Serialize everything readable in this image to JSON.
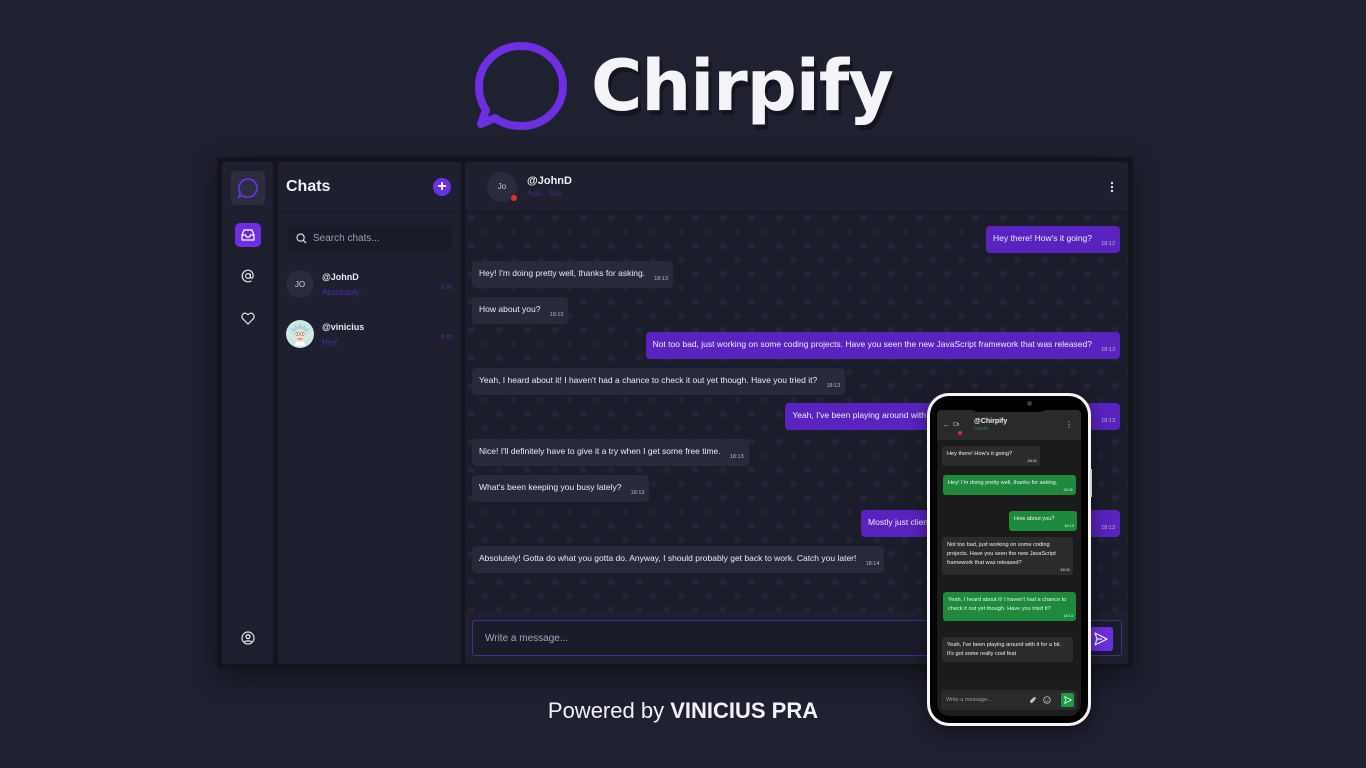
{
  "brand": {
    "name": "Chirpify",
    "accent": "#6d2fe0",
    "phone_accent": "#1e8a3d"
  },
  "sidebar": {
    "items": [
      {
        "icon": "logo-icon"
      },
      {
        "icon": "inbox-icon",
        "active": true
      },
      {
        "icon": "at-sign-icon"
      },
      {
        "icon": "heart-icon"
      },
      {
        "icon": "user-circle-icon"
      }
    ]
  },
  "chats_panel": {
    "title": "Chats",
    "new_chat_label": "+",
    "search_placeholder": "Search chats...",
    "items": [
      {
        "avatar": "JO",
        "name": "@JohnD",
        "preview": "Absolutely...",
        "time": "1 m"
      },
      {
        "avatar": "",
        "name": "@vinicius",
        "preview": "Hey!",
        "time": "4 m"
      }
    ]
  },
  "conversation": {
    "avatar": "Jo",
    "name": "@JohnD",
    "status": "Acti... Dia",
    "composer_placeholder": "Write a message...",
    "messages": [
      {
        "dir": "out",
        "text": "Hey there! How's it going?",
        "time": "18:12"
      },
      {
        "dir": "in",
        "text": "Hey! I'm doing pretty well, thanks for asking.",
        "time": "18:13"
      },
      {
        "dir": "in",
        "text": "How about you?",
        "time": "18:13"
      },
      {
        "dir": "out",
        "text": "Not too bad, just working on some coding projects. Have you seen the new JavaScript framework that was released?",
        "time": "18:13"
      },
      {
        "dir": "in",
        "text": "Yeah, I heard about it! I haven't had a chance to check it out yet though. Have you tried it?",
        "time": "18:13"
      },
      {
        "dir": "out",
        "text": "Yeah, I've been playing around with it for a bit. It's got some really cool features.",
        "time": "18:13"
      },
      {
        "dir": "in",
        "text": "Nice! I'll definitely have to give it a try when I get some free time.",
        "time": "18:13"
      },
      {
        "dir": "in",
        "text": "What's been keeping you busy lately?",
        "time": "18:13"
      },
      {
        "dir": "out",
        "text": "Mostly just client work, trying to meet deadlines and all that.",
        "time": "18:13"
      },
      {
        "dir": "in",
        "text": "Absolutely! Gotta do what you gotta do. Anyway, I should probably get back to work. Catch you later!",
        "time": "18:14"
      }
    ]
  },
  "phone": {
    "back_label": "←",
    "avatar": "Ch",
    "name": "@Chirpify",
    "status": "Lorem",
    "composer_placeholder": "Write a message...",
    "messages": [
      {
        "dir": "in",
        "text": "Hey there! How's it going?",
        "time": "18:11"
      },
      {
        "dir": "out",
        "text": "Hey! I'm doing pretty well, thanks for asking.",
        "time": "18:11"
      },
      {
        "dir": "out",
        "text": "How about you?",
        "time": "18:13"
      },
      {
        "dir": "in",
        "text": "Not too bad, just working on some coding projects. Have you seen the new JavaScript framework that was released?",
        "time": "18:11"
      },
      {
        "dir": "out",
        "text": "Yeah, I heard about it! I haven't had a chance to check it out yet though. Have you tried it?",
        "time": "18:13"
      },
      {
        "dir": "in",
        "text": "Yeah, I've been playing around with it for a bit. It's got some really cool feat",
        "time": ""
      }
    ]
  },
  "footer": {
    "prefix": "Powered by ",
    "author": "VINICIUS PRA"
  }
}
